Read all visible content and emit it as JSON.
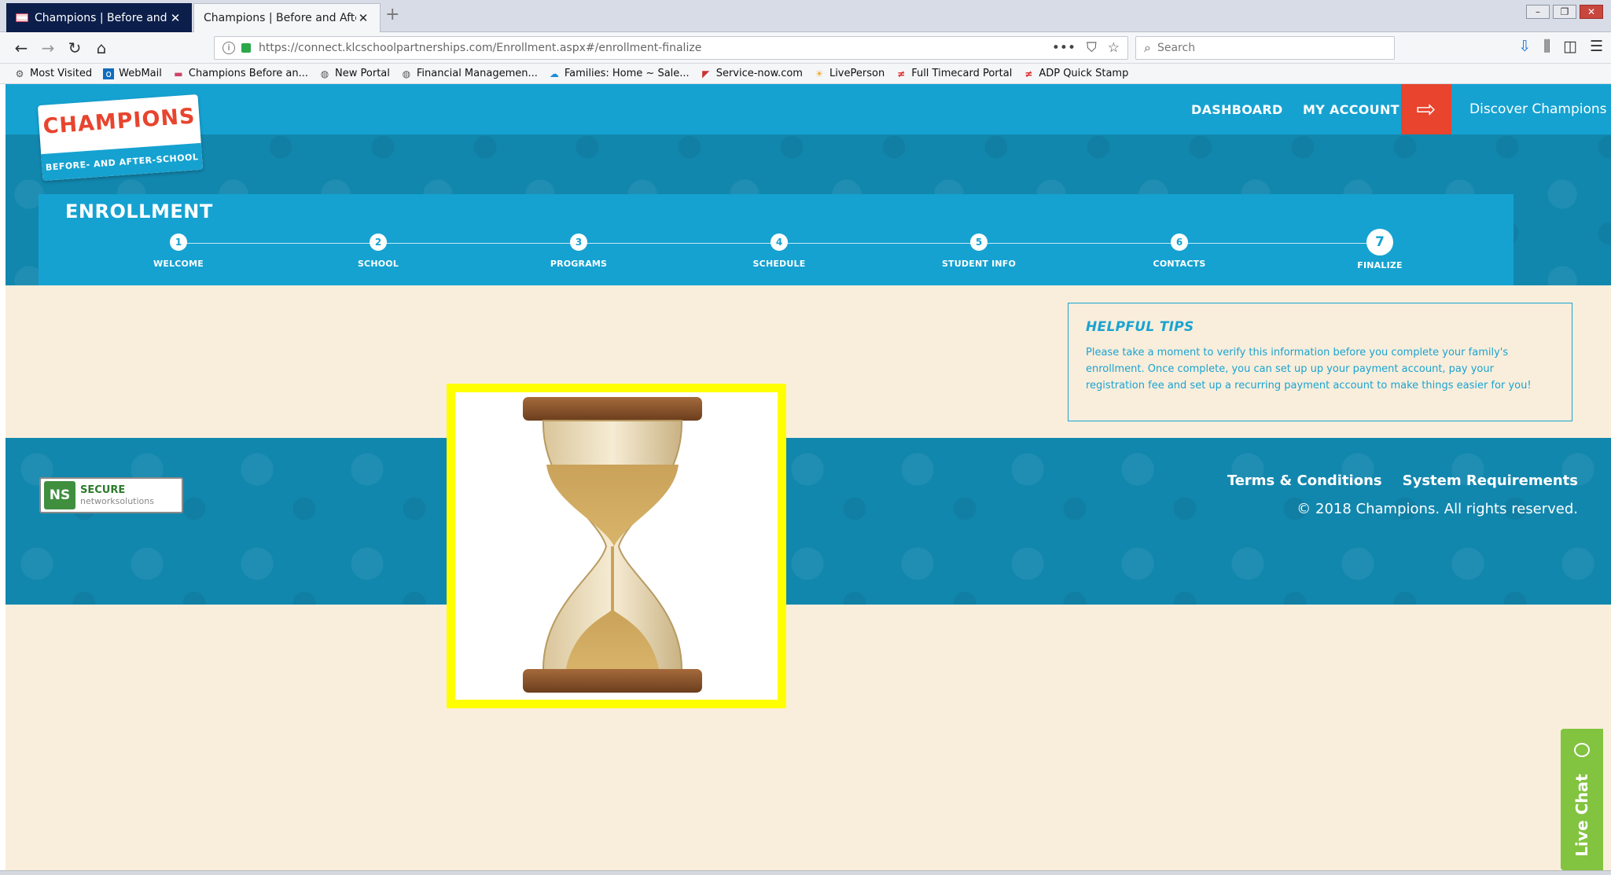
{
  "browser": {
    "tabs": [
      {
        "title": "Champions | Before and After S",
        "active": false
      },
      {
        "title": "Champions | Before and After Scho",
        "active": true
      }
    ],
    "new_tab": "+",
    "url": "https://connect.klcschoolpartnerships.com/Enrollment.aspx#/enrollment-finalize",
    "search_placeholder": "Search",
    "bookmarks": [
      {
        "label": "Most Visited",
        "icon": "gear-icon"
      },
      {
        "label": "WebMail",
        "icon": "outlook-icon"
      },
      {
        "label": "Champions  Before an...",
        "icon": "flag-icon"
      },
      {
        "label": "New Portal",
        "icon": "globe-icon"
      },
      {
        "label": "Financial Managemen...",
        "icon": "globe-icon"
      },
      {
        "label": "Families: Home ~ Sale...",
        "icon": "cloud-icon"
      },
      {
        "label": "Service-now.com",
        "icon": "servicenow-icon"
      },
      {
        "label": "LivePerson",
        "icon": "sun-icon"
      },
      {
        "label": "Full Timecard Portal",
        "icon": "adp-icon"
      },
      {
        "label": "ADP Quick Stamp",
        "icon": "adp-icon"
      }
    ]
  },
  "site": {
    "logo_word": "CHAMPIONS",
    "logo_tagline": "BEFORE- AND AFTER-SCHOOL",
    "nav": {
      "dashboard": "DASHBOARD",
      "my_account": "MY ACCOUNT",
      "discover": "Discover Champions"
    },
    "enrollment": {
      "title": "ENROLLMENT",
      "current_step": 7,
      "steps": [
        {
          "number": "1",
          "label": "WELCOME"
        },
        {
          "number": "2",
          "label": "SCHOOL"
        },
        {
          "number": "3",
          "label": "PROGRAMS"
        },
        {
          "number": "4",
          "label": "SCHEDULE"
        },
        {
          "number": "5",
          "label": "STUDENT INFO"
        },
        {
          "number": "6",
          "label": "CONTACTS"
        },
        {
          "number": "7",
          "label": "FINALIZE"
        }
      ]
    },
    "tips": {
      "heading": "HELPFUL TIPS",
      "body": "Please take a moment to verify this information before you complete your family's enrollment. Once complete, you can set up up your payment account, pay your registration fee and set up a recurring payment account to make things easier for you!"
    },
    "footer": {
      "badge_secure": "SECURE",
      "badge_vendor": "networksolutions",
      "badge_mark": "NS",
      "terms": "Terms & Conditions",
      "requirements": "System Requirements",
      "copyright": "© 2018 Champions. All rights reserved."
    },
    "live_chat": "Live Chat"
  },
  "colors": {
    "primary_blue": "#15a2d1",
    "dark_blue": "#1287ae",
    "accent_red": "#e8442e",
    "cream": "#f9eedb",
    "chat_green": "#82c340",
    "highlight_yellow": "#ffff00"
  }
}
